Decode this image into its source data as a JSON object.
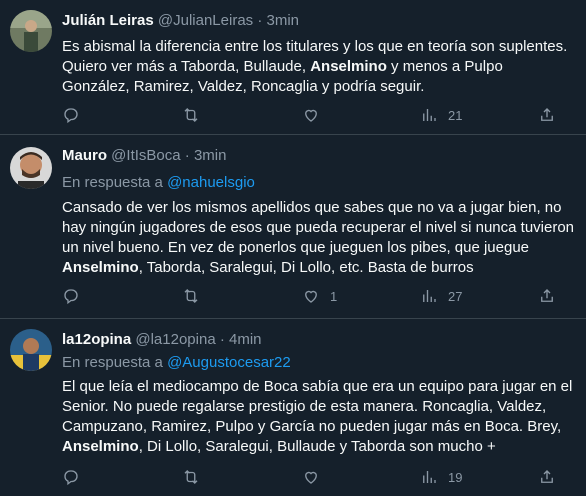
{
  "tweets": [
    {
      "name": "Julián Leiras",
      "handle": "@JulianLeiras",
      "dot": "·",
      "time": "3min",
      "reply_prefix": "",
      "reply_to": "",
      "text_parts": [
        "Es abismal la diferencia entre los titulares y los que en teoría son suplentes. Quiero ver más a Taborda, Bullaude, ",
        "Anselmino",
        " y menos a Pulpo González, Ramirez, Valdez, Roncaglia y podría seguir."
      ],
      "likes": "",
      "views": "21"
    },
    {
      "name": "Mauro",
      "handle": "@ItIsBoca",
      "dot": "·",
      "time": "3min",
      "reply_prefix": "En respuesta a",
      "reply_to": "@nahuelsgio",
      "text_parts": [
        "Cansado de ver los mismos apellidos que sabes que no va a jugar bien, no hay ningún jugadores de esos que pueda recuperar el nivel si nunca tuvieron un nivel bueno. En vez de ponerlos que jueguen los pibes, que juegue ",
        "Anselmino",
        ", Taborda, Saralegui, Di Lollo, etc. Basta de burros"
      ],
      "likes": "1",
      "views": "27"
    },
    {
      "name": "la12opina",
      "handle": "@la12opina",
      "dot": "·",
      "time": "4min",
      "reply_prefix": "En respuesta a",
      "reply_to": "@Augustocesar22",
      "text_parts": [
        "El que leía el mediocampo de Boca sabía que era un equipo para jugar en el Senior. No puede regalarse prestigio de esta manera. Roncaglia, Valdez, Campuzano, Ramirez, Pulpo y García no pueden jugar más en Boca. Brey, ",
        "Anselmino",
        ", Di Lollo, Saralegui, Bullaude y Taborda son mucho +"
      ],
      "likes": "",
      "views": "19"
    }
  ],
  "icons": {
    "reply": "reply-icon",
    "retweet": "retweet-icon",
    "like": "heart-icon",
    "views": "views-icon",
    "share": "share-icon"
  },
  "colors": {
    "background": "#15202b",
    "text": "#f7f9f9",
    "muted": "#8b98a5",
    "link": "#1d9bf0",
    "border": "#38444d"
  }
}
